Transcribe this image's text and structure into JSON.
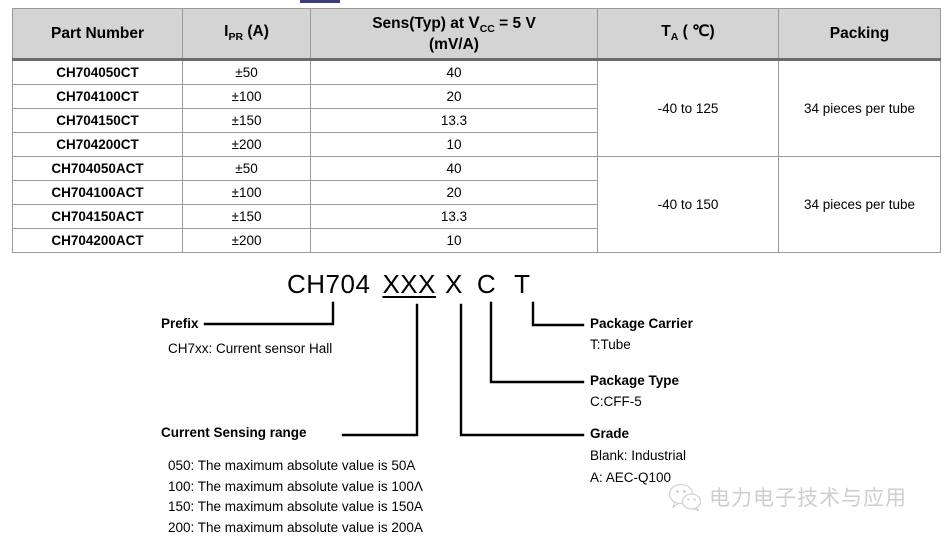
{
  "table": {
    "headers": [
      {
        "id": "part_number",
        "text": "Part Number"
      },
      {
        "id": "ipr",
        "text": "I PR (A)",
        "main": "I",
        "sub": "PR",
        "tail": " (A)"
      },
      {
        "id": "sens",
        "text": "Sens(Typ) at VCC = 5 V (mV/A)",
        "line1_a": "Sens(Typ) at ",
        "line1_v": "V",
        "line1_sub": "CC",
        "line1_b": " = 5 V",
        "line2": "(mV/A)"
      },
      {
        "id": "ta",
        "text": "TA (℃)",
        "main": "T",
        "sub": "A",
        "tail": " ( ℃)"
      },
      {
        "id": "packing",
        "text": "Packing"
      }
    ],
    "rows": [
      {
        "part": "CH704050CT",
        "ipr": "±50",
        "sens": "40"
      },
      {
        "part": "CH704100CT",
        "ipr": "±100",
        "sens": "20"
      },
      {
        "part": "CH704150CT",
        "ipr": "±150",
        "sens": "13.3"
      },
      {
        "part": "CH704200CT",
        "ipr": "±200",
        "sens": "10"
      },
      {
        "part": "CH704050ACT",
        "ipr": "±50",
        "sens": "40"
      },
      {
        "part": "CH704100ACT",
        "ipr": "±100",
        "sens": "20"
      },
      {
        "part": "CH704150ACT",
        "ipr": "±150",
        "sens": "13.3"
      },
      {
        "part": "CH704200ACT",
        "ipr": "±200",
        "sens": "10"
      }
    ],
    "groups": [
      {
        "ta": "-40 to 125",
        "packing": "34 pieces per tube"
      },
      {
        "ta": "-40 to 150",
        "packing": "34 pieces per tube"
      }
    ]
  },
  "decoder": {
    "code": {
      "prefix": "CH704",
      "range": "XXX",
      "grade": "X",
      "package_type": "C",
      "package_carrier": "T"
    },
    "prefix": {
      "label": "Prefix",
      "value": "CH7xx: Current sensor Hall"
    },
    "sensing_range": {
      "label": "Current Sensing range",
      "items": [
        "050: The maximum absolute value is 50A",
        "100: The maximum absolute value is 100Λ",
        "150: The maximum absolute value is 150A",
        "200: The maximum absolute value is 200A"
      ]
    },
    "package_carrier": {
      "label": "Package Carrier",
      "value": "T:Tube"
    },
    "package_type": {
      "label": "Package Type",
      "value": "C:CFF-5"
    },
    "grade": {
      "label": "Grade",
      "value1": "Blank: Industrial",
      "value2": "A: AEC-Q100"
    }
  },
  "watermark": {
    "text": "电力电子技术与应用",
    "icon": "wechat-icon"
  },
  "colors": {
    "header_bg": "#d4d4d4",
    "border": "#9a9a9a",
    "header_rule": "#6b6b6b",
    "text": "#000000",
    "watermark": "#8d8d8d"
  }
}
